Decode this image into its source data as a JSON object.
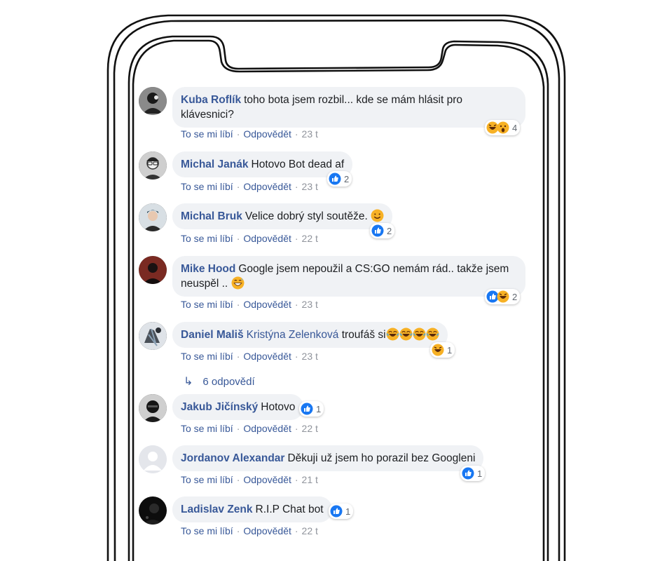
{
  "actions": {
    "like": "To se mi líbí",
    "reply": "Odpovědět",
    "sep": "·"
  },
  "replies": {
    "label": "6 odpovědí"
  },
  "comments": [
    {
      "author": "Kuba Roflík",
      "text": "toho bota jsem rozbil... kde se mám hlásit pro klávesnici?",
      "time": "23 t",
      "reactions": [
        "haha",
        "wow"
      ],
      "count": "4"
    },
    {
      "author": "Michal Janák",
      "text": "Hotovo Bot dead af",
      "time": "23 t",
      "reactions": [
        "like"
      ],
      "count": "2"
    },
    {
      "author": "Michal Bruk",
      "text": "Velice dobrý styl soutěže.",
      "time": "22 t",
      "reactions": [
        "like"
      ],
      "count": "2"
    },
    {
      "author": "Mike Hood",
      "text": "Google jsem nepoužil a CS:GO nemám rád.. takže jsem neuspěl ..",
      "time": "23 t",
      "reactions": [
        "like",
        "haha"
      ],
      "count": "2"
    },
    {
      "author": "Daniel Mališ",
      "mention": "Kristýna Zelenková",
      "text": "troufáš si",
      "time": "23 t",
      "reactions": [
        "haha"
      ],
      "count": "1"
    },
    {
      "author": "Jakub Jičínský",
      "text": "Hotovo",
      "time": "22 t",
      "reactions": [
        "like"
      ],
      "count": "1"
    },
    {
      "author": "Jordanov Alexandar",
      "text": "Děkuji už jsem ho porazil bez Googleni",
      "time": "21 t",
      "reactions": [
        "like"
      ],
      "count": "1"
    },
    {
      "author": "Ladislav Zenk",
      "text": "R.I.P Chat bot",
      "time": "22 t",
      "reactions": [
        "like"
      ],
      "count": "1"
    }
  ],
  "colors": {
    "link": "#385898",
    "bubble": "#f0f2f5",
    "like": "#1877f2",
    "emoji": "#f7b125",
    "meta": "#90949c"
  }
}
